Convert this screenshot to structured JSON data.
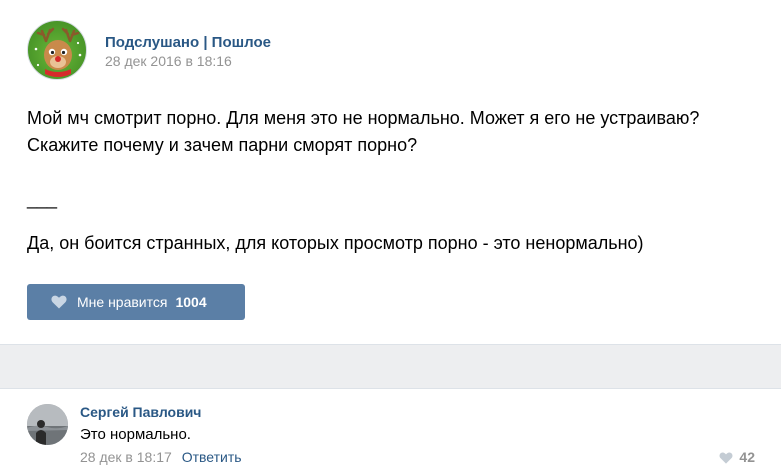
{
  "post": {
    "group_name": "Подслушано | Пошлое",
    "date": "28 дек 2016 в 18:16",
    "text_line1": "Мой мч смотрит порно. Для меня это не нормально. Может я его не устраиваю?",
    "text_line2": "Скажите почему и зачем парни сморят порно?",
    "divider_text": "___",
    "answer_text": "Да, он боится странных, для которых просмотр порно - это ненормально)",
    "like_label": "Мне нравится",
    "like_count": "1004",
    "like_icon": "heart-icon"
  },
  "comment": {
    "author": "Сергей Павлович",
    "text": "Это нормально.",
    "date": "28 дек в 18:17",
    "reply_label": "Ответить",
    "likes": "42",
    "like_icon": "heart-icon"
  },
  "colors": {
    "link": "#2a5885",
    "button": "#5b7fa6",
    "meta": "#939393",
    "separator": "#edeef0"
  }
}
